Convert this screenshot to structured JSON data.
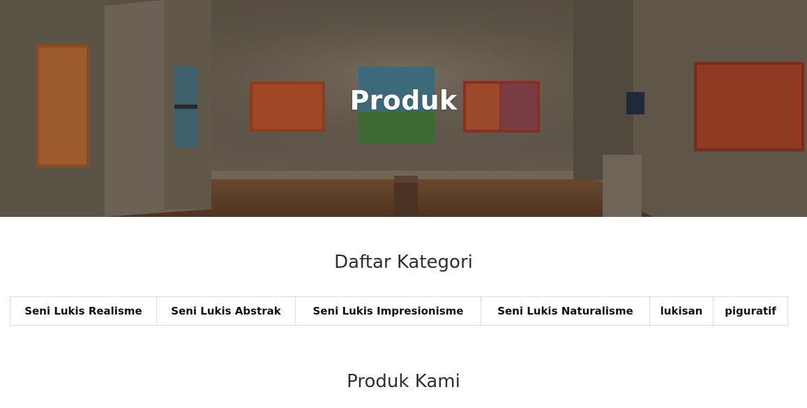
{
  "hero": {
    "title": "Produk",
    "background": "art-gallery-photo"
  },
  "categories": {
    "title": "Daftar Kategori",
    "items": [
      "Seni Lukis Realisme",
      "Seni Lukis Abstrak",
      "Seni Lukis Impresionisme",
      "Seni Lukis Naturalisme",
      "lukisan",
      "piguratif"
    ]
  },
  "products": {
    "title": "Produk Kami"
  }
}
